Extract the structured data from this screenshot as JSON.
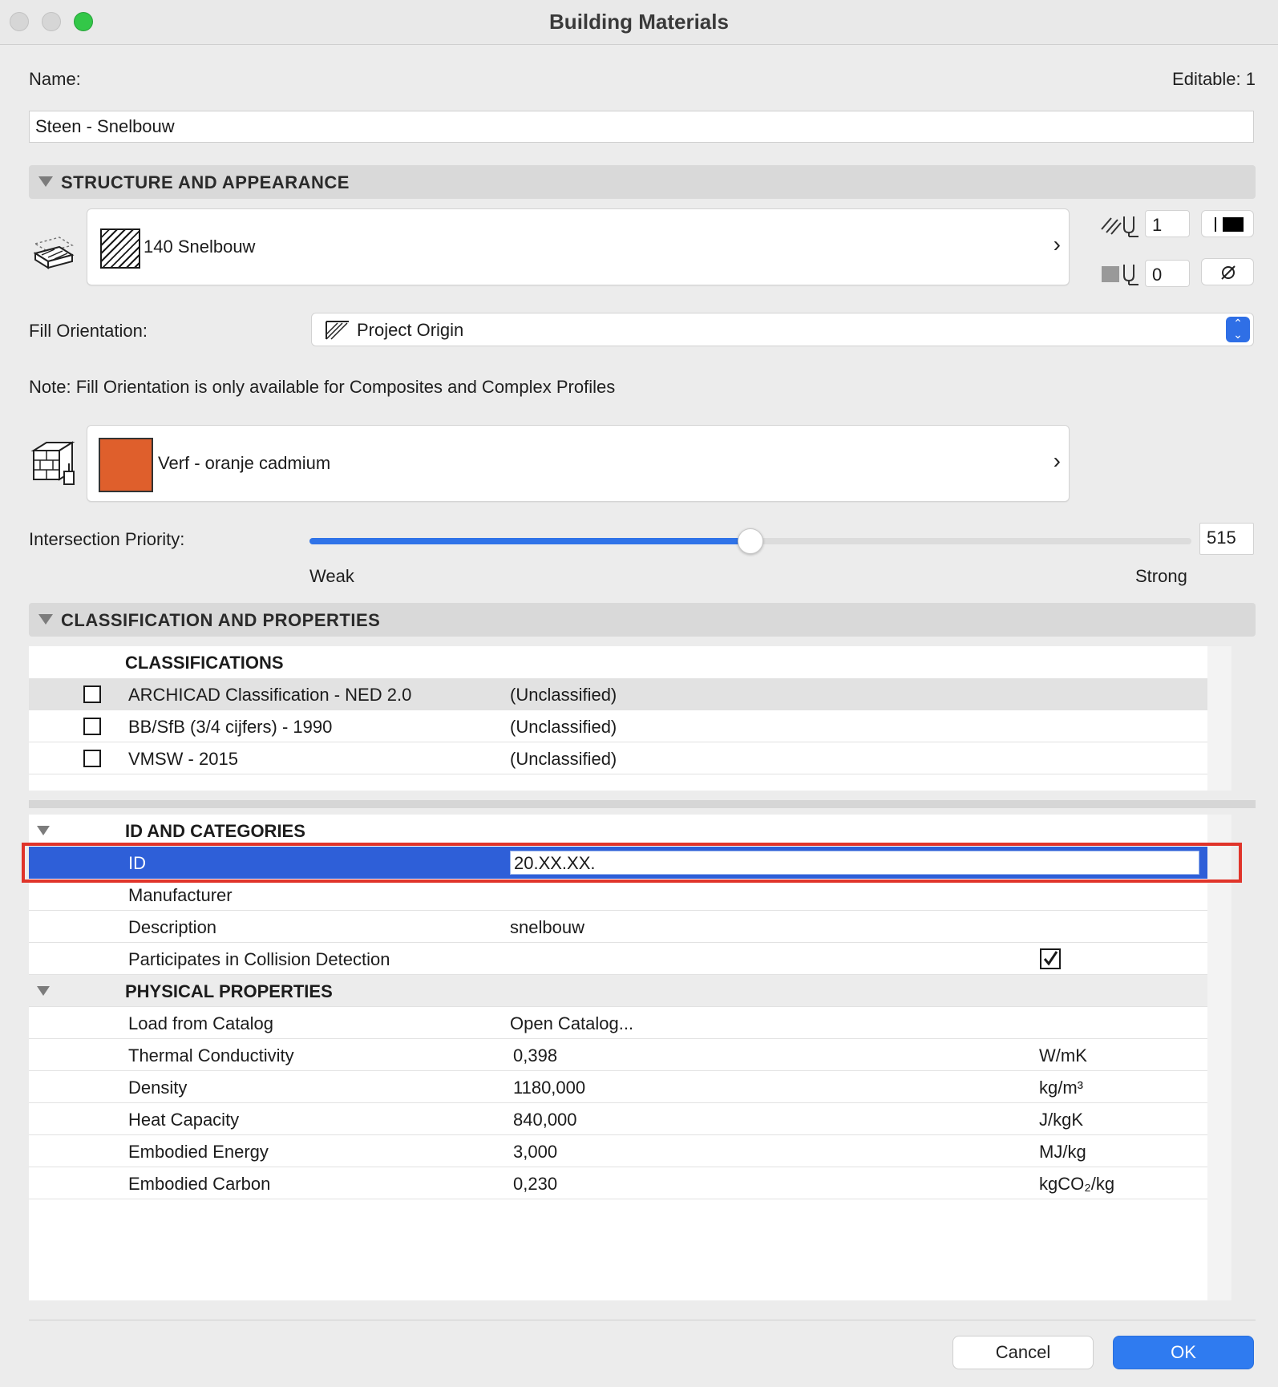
{
  "window": {
    "title": "Building Materials"
  },
  "name_section": {
    "label": "Name:",
    "editable": "Editable: 1",
    "value": "Steen - Snelbouw"
  },
  "structure": {
    "title": "STRUCTURE AND APPEARANCE",
    "cut_fill": "140 Snelbouw",
    "fg_pen": "1",
    "bg_pen": "0",
    "fill_orientation_label": "Fill Orientation:",
    "fill_orientation_value": "Project Origin",
    "note": "Note: Fill Orientation is only available for Composites and Complex Profiles",
    "surface": "Verf - oranje cadmium",
    "surface_color": "#df5f2c",
    "intersection_label": "Intersection Priority:",
    "intersection_value": "515",
    "intersection_fraction": 0.5,
    "weak": "Weak",
    "strong": "Strong"
  },
  "classification": {
    "title": "CLASSIFICATION AND PROPERTIES",
    "header": "CLASSIFICATIONS",
    "rows": [
      {
        "name": "ARCHICAD Classification - NED 2.0",
        "value": "(Unclassified)"
      },
      {
        "name": "BB/SfB (3/4 cijfers) - 1990",
        "value": "(Unclassified)"
      },
      {
        "name": "VMSW - 2015",
        "value": "(Unclassified)"
      }
    ]
  },
  "properties": {
    "id_group": "ID AND CATEGORIES",
    "id_label": "ID",
    "id_value": "20.XX.XX.",
    "manufacturer": "Manufacturer",
    "description_label": "Description",
    "description_value": "snelbouw",
    "collision_label": "Participates in Collision Detection",
    "physical_group": "PHYSICAL PROPERTIES",
    "catalog_label": "Load from Catalog",
    "catalog_value": "Open Catalog...",
    "rows": [
      {
        "name": "Thermal Conductivity",
        "value": "0,398",
        "unit": "W/mK"
      },
      {
        "name": "Density",
        "value": "1180,000",
        "unit": "kg/m³"
      },
      {
        "name": "Heat Capacity",
        "value": "840,000",
        "unit": "J/kgK"
      },
      {
        "name": "Embodied Energy",
        "value": "3,000",
        "unit": "MJ/kg"
      },
      {
        "name": "Embodied Carbon",
        "value": "0,230",
        "unit": "kgCO₂/kg"
      }
    ]
  },
  "buttons": {
    "cancel": "Cancel",
    "ok": "OK"
  }
}
